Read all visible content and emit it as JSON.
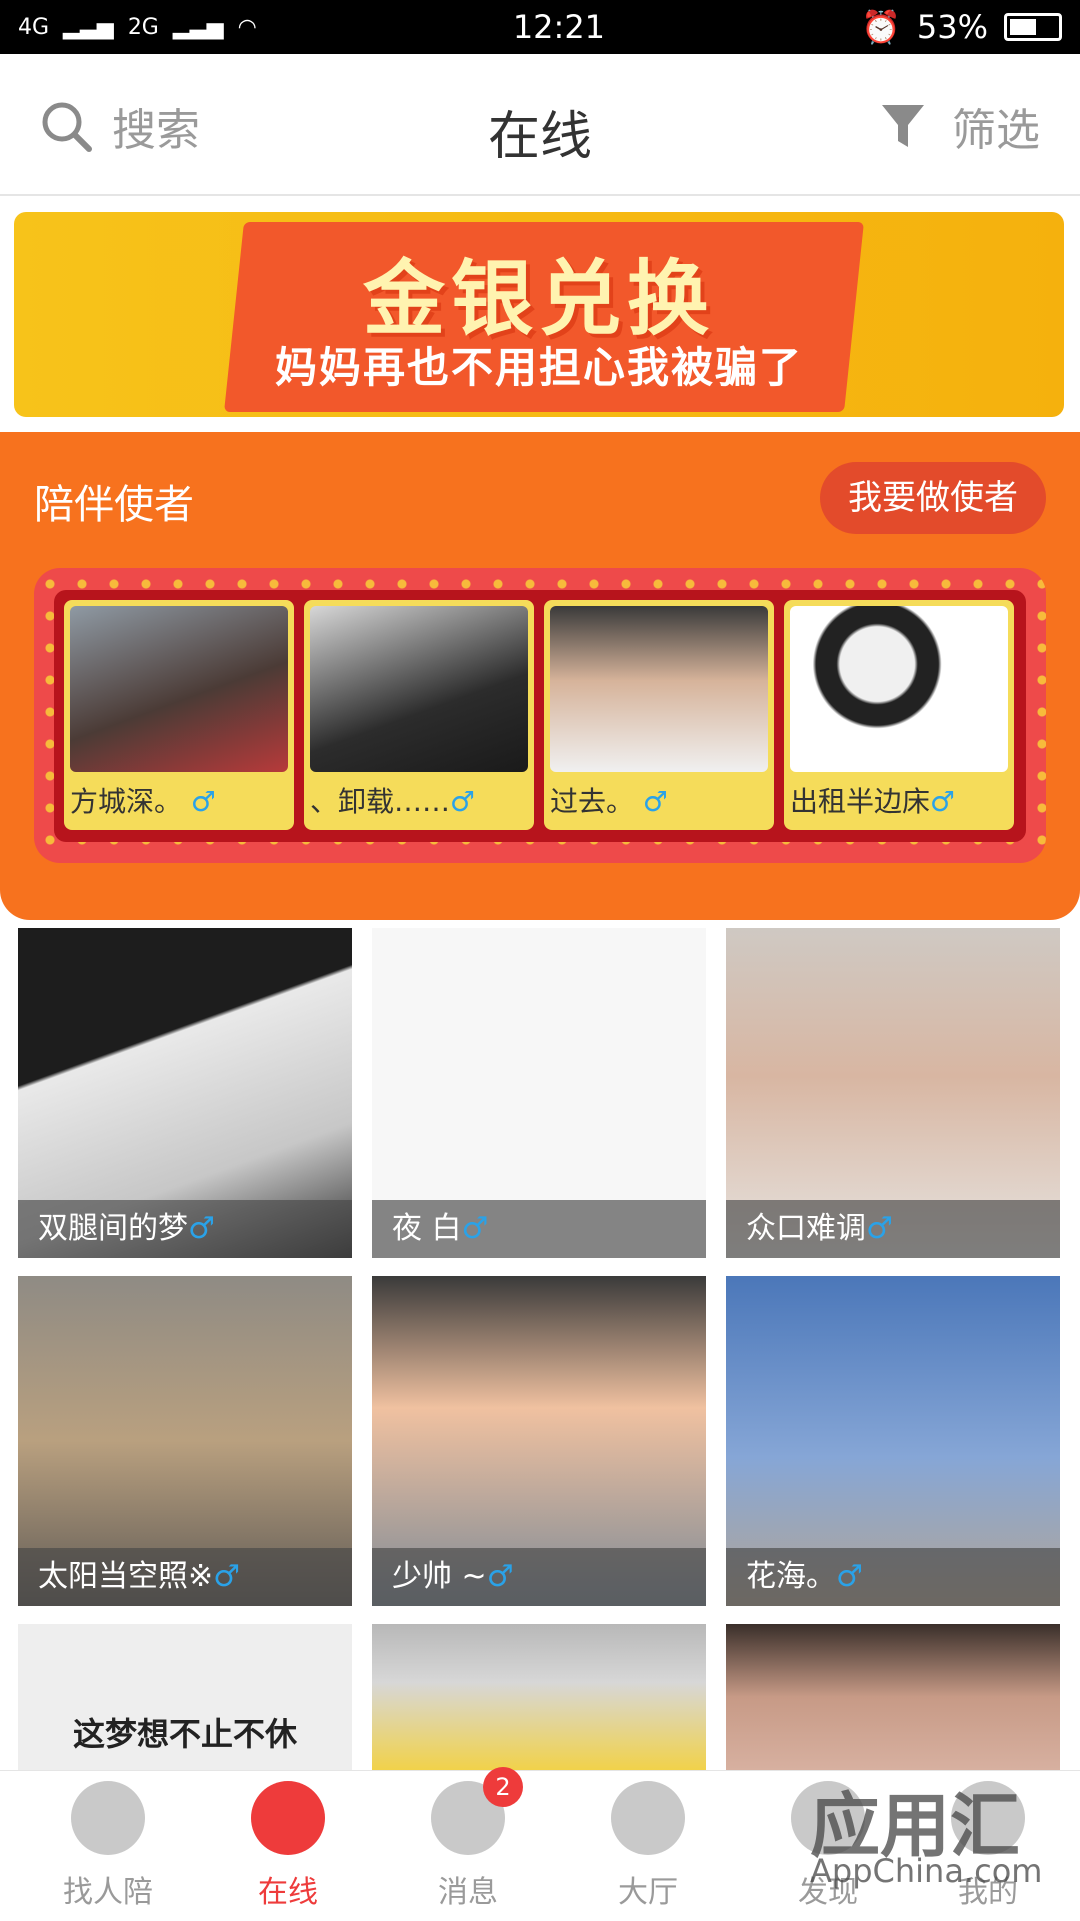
{
  "status_bar": {
    "network_left": "4G",
    "network_right": "2G",
    "time": "12:21",
    "battery": "53%"
  },
  "header": {
    "search_label": "搜索",
    "title": "在线",
    "filter_label": "筛选"
  },
  "banner": {
    "title": "金银兑换",
    "subtitle": "妈妈再也不用担心我被骗了"
  },
  "escort": {
    "section_title": "陪伴使者",
    "button_label": "我要做使者",
    "cards": [
      {
        "name": "方城深。",
        "gender": "♂"
      },
      {
        "name": "、卸载……",
        "gender": "♂"
      },
      {
        "name": "过去。",
        "gender": "♂"
      },
      {
        "name": "出租半边床",
        "gender": "♂"
      }
    ]
  },
  "grid_users": [
    {
      "name": "双腿间的梦",
      "gender": "♂"
    },
    {
      "name": "夜 白",
      "gender": "♂"
    },
    {
      "name": "众口难调",
      "gender": "♂"
    },
    {
      "name": "太阳当空照※",
      "gender": "♂"
    },
    {
      "name": "少帅 ~",
      "gender": "♂"
    },
    {
      "name": "花海。",
      "gender": "♂"
    },
    {
      "name": "",
      "gender": "",
      "image_text": "这梦想不止不休"
    },
    {
      "name": "",
      "gender": ""
    },
    {
      "name": "",
      "gender": ""
    }
  ],
  "tabbar": {
    "tabs": [
      {
        "label": "找人陪",
        "icon": "heart-icon"
      },
      {
        "label": "在线",
        "icon": "pulse-heart-icon"
      },
      {
        "label": "消息",
        "icon": "chat-icon",
        "badge": "2"
      },
      {
        "label": "大厅",
        "icon": "home-icon"
      },
      {
        "label": "发现",
        "icon": "compass-icon"
      },
      {
        "label": "我的",
        "icon": "profile-icon"
      }
    ]
  },
  "watermark": {
    "text": "应用汇",
    "url": "AppChina.com"
  },
  "colors": {
    "accent_orange": "#f7721e",
    "accent_red": "#ee3b3b",
    "male_blue": "#2aa2e8"
  }
}
